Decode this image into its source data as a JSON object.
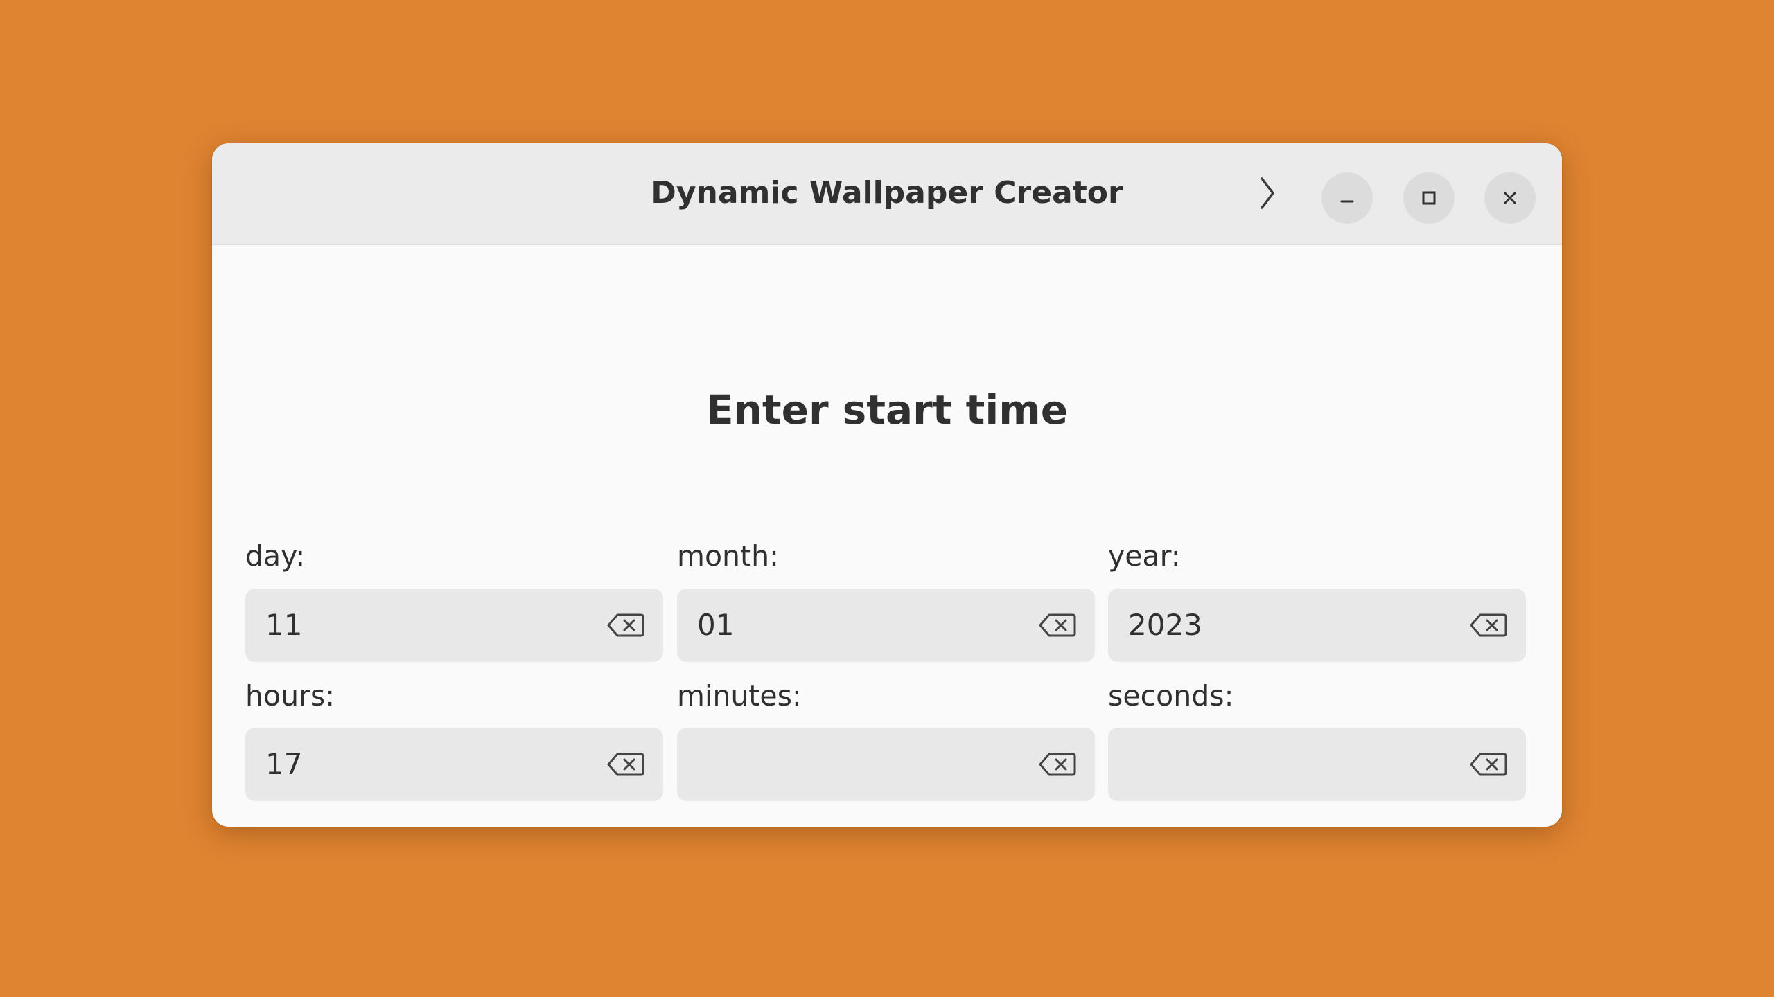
{
  "window": {
    "title": "Dynamic Wallpaper Creator"
  },
  "titlebar": {
    "buttons": [
      {
        "name": "next-page",
        "icon": "chevron-right-icon"
      },
      {
        "name": "minimize",
        "icon": "minimize-icon"
      },
      {
        "name": "maximize",
        "icon": "maximize-icon"
      },
      {
        "name": "close",
        "icon": "close-icon"
      }
    ]
  },
  "main": {
    "heading": "Enter start time",
    "fields": {
      "day": {
        "label": "day:",
        "value": "11"
      },
      "month": {
        "label": "month:",
        "value": "01"
      },
      "year": {
        "label": "year:",
        "value": "2023"
      },
      "hours": {
        "label": "hours:",
        "value": "17"
      },
      "minutes": {
        "label": "minutes:",
        "value": ""
      },
      "seconds": {
        "label": "seconds:",
        "value": ""
      }
    },
    "clear_icon": "backspace-icon"
  },
  "colors": {
    "desktop_background": "#df8431",
    "window_background": "#fafafa",
    "titlebar_background": "#ebebeb",
    "entry_background": "#e8e8e8",
    "text": "#303030"
  }
}
